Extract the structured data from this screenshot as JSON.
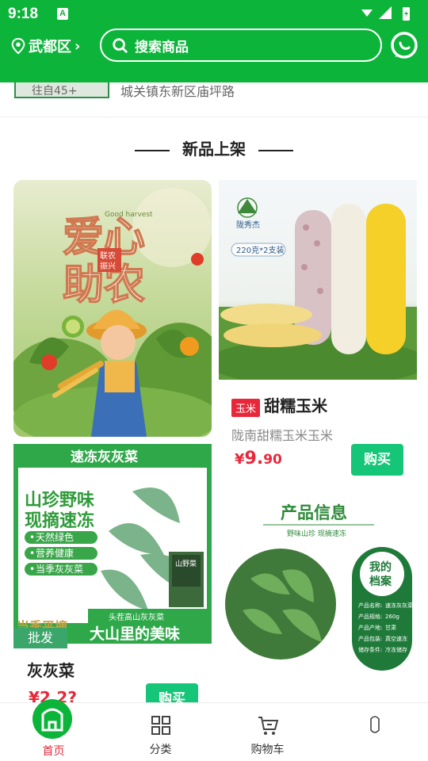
{
  "status_bar": {
    "time": "9:18",
    "notif_letter": "A"
  },
  "header": {
    "location": "武都区",
    "location_chevron": "›",
    "search_placeholder": "搜索商品"
  },
  "strip": {
    "tag_text": "往自45+",
    "address": "城关镇东新区庙坪路"
  },
  "section": {
    "title": "新品上架"
  },
  "left_banner": {
    "title_line1": "爱心",
    "title_line2": "助农",
    "stamp": "联农\n振兴",
    "subtitle_small": "Good harvest"
  },
  "corn_card": {
    "brand": "陇秀杰",
    "weight_tag": "220克*2支装",
    "badge": "玉米",
    "name": "甜糯玉米",
    "subname": "陇南甜糯玉米玉米",
    "price_symbol": "¥",
    "price_int": "9.",
    "price_dec": "90",
    "buy_label": "购买"
  },
  "greens_card": {
    "banner_top": "速冻灰灰菜",
    "headline1": "山珍野味",
    "headline2": "现摘速冻",
    "bullets": [
      "天然绿色",
      "营养健康",
      "当季灰灰菜"
    ],
    "pkg_label": "山野菜",
    "bottom_small": "头茬高山灰灰菜",
    "bottom_big": "大山里的美味",
    "corner_text": "当季平摘",
    "tag": "批发",
    "name": "灰灰菜",
    "price_text": "¥2.2?",
    "buy_label": "购买"
  },
  "info_card": {
    "title": "产品信息",
    "subtitle": "野味山珍 现摘速冻",
    "archive_line1": "我的",
    "archive_line2": "档案",
    "specs": [
      [
        "产品名称:",
        "速冻灰灰菜"
      ],
      [
        "产品规格:",
        "260g"
      ],
      [
        "产品产地:",
        "甘肃"
      ],
      [
        "产品包装:",
        "真空速冻"
      ],
      [
        "储存条件:",
        "冷冻储存"
      ]
    ]
  },
  "tabbar": {
    "tabs": [
      {
        "label": "首页",
        "active": true
      },
      {
        "label": "分类",
        "active": false
      },
      {
        "label": "购物车",
        "active": false
      },
      {
        "label": "",
        "active": false
      }
    ]
  },
  "colors": {
    "brand_green": "#0cb43a",
    "price_red": "#e8283a",
    "buy_green": "#16c678"
  }
}
